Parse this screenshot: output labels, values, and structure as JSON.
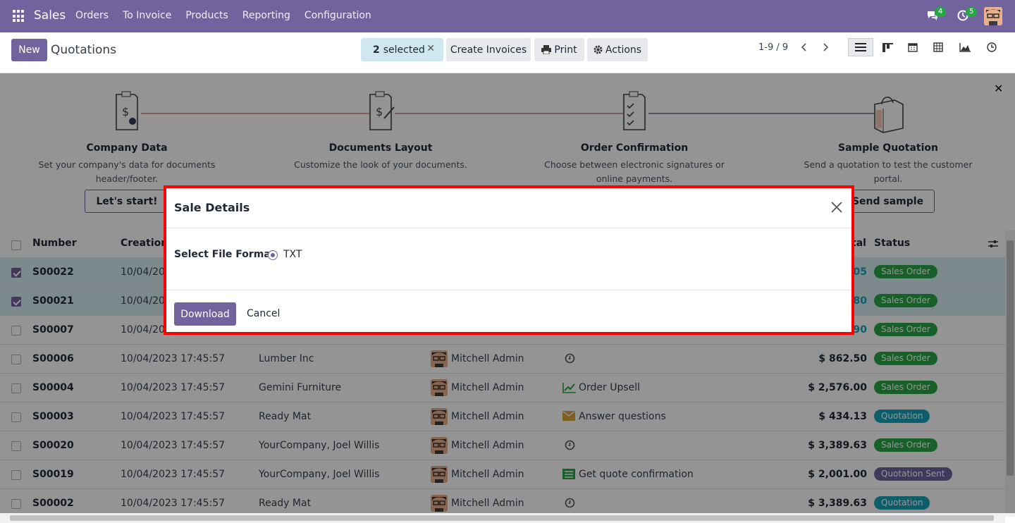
{
  "topbar": {
    "app_name": "Sales",
    "menu": [
      "Orders",
      "To Invoice",
      "Products",
      "Reporting",
      "Configuration"
    ],
    "messages_count": "4",
    "activities_count": "5"
  },
  "control_panel": {
    "new_label": "New",
    "title": "Quotations",
    "selected_count": "2",
    "selected_label": "selected",
    "create_invoices": "Create Invoices",
    "print": "Print",
    "actions": "Actions",
    "pager": "1-9 / 9"
  },
  "helper": {
    "steps": [
      {
        "title": "Company Data",
        "desc": "Set your company's data for documents header/footer.",
        "button": "Let's start!"
      },
      {
        "title": "Documents Layout",
        "desc": "Customize the look of your documents.",
        "button": ""
      },
      {
        "title": "Order Confirmation",
        "desc": "Choose between electronic signatures or online payments.",
        "button": ""
      },
      {
        "title": "Sample Quotation",
        "desc": "Send a quotation to test the customer portal.",
        "button": "Send sample"
      }
    ]
  },
  "table": {
    "headers": {
      "number": "Number",
      "creation": "Creation",
      "total": "tal",
      "status": "Status"
    },
    "rows": [
      {
        "number": "S00022",
        "date": "10/04/20",
        "customer": "",
        "salesperson": "",
        "activity": "",
        "total": "05",
        "status": "Sales Order",
        "selected": true
      },
      {
        "number": "S00021",
        "date": "10/04/20",
        "customer": "",
        "salesperson": "",
        "activity": "",
        "total": "80",
        "status": "Sales Order",
        "selected": true
      },
      {
        "number": "S00007",
        "date": "10/04/20",
        "customer": "",
        "salesperson": "",
        "activity": "",
        "total": "90",
        "status": "Sales Order",
        "selected": false
      },
      {
        "number": "S00006",
        "date": "10/04/2023 17:45:57",
        "customer": "Lumber Inc",
        "salesperson": "Mitchell Admin",
        "activity": "",
        "total": "$ 862.50",
        "status": "Sales Order",
        "selected": false
      },
      {
        "number": "S00004",
        "date": "10/04/2023 17:45:57",
        "customer": "Gemini Furniture",
        "salesperson": "Mitchell Admin",
        "activity": "Order Upsell",
        "total": "$ 2,576.00",
        "status": "Sales Order",
        "selected": false
      },
      {
        "number": "S00003",
        "date": "10/04/2023 17:45:57",
        "customer": "Ready Mat",
        "salesperson": "Mitchell Admin",
        "activity": "Answer questions",
        "total": "$ 434.13",
        "status": "Quotation",
        "selected": false
      },
      {
        "number": "S00020",
        "date": "10/04/2023 17:45:57",
        "customer": "YourCompany, Joel Willis",
        "salesperson": "Mitchell Admin",
        "activity": "",
        "total": "$ 3,389.63",
        "status": "Sales Order",
        "selected": false
      },
      {
        "number": "S00019",
        "date": "10/04/2023 17:45:57",
        "customer": "YourCompany, Joel Willis",
        "salesperson": "Mitchell Admin",
        "activity": "Get quote confirmation",
        "total": "$ 2,001.00",
        "status": "Quotation Sent",
        "selected": false
      },
      {
        "number": "S00002",
        "date": "10/04/2023 17:45:57",
        "customer": "Ready Mat",
        "salesperson": "Mitchell Admin",
        "activity": "",
        "total": "$ 3,389.63",
        "status": "Quotation",
        "selected": false
      }
    ]
  },
  "modal": {
    "title": "Sale Details",
    "format_label": "Select File Format",
    "format_option": "TXT",
    "download": "Download",
    "cancel": "Cancel"
  },
  "colors": {
    "brand": "#71639e",
    "highlight_border": "#ff0000",
    "sales_order": "#28a745",
    "quotation": "#17a2b8",
    "quotation_sent": "#71639e"
  }
}
